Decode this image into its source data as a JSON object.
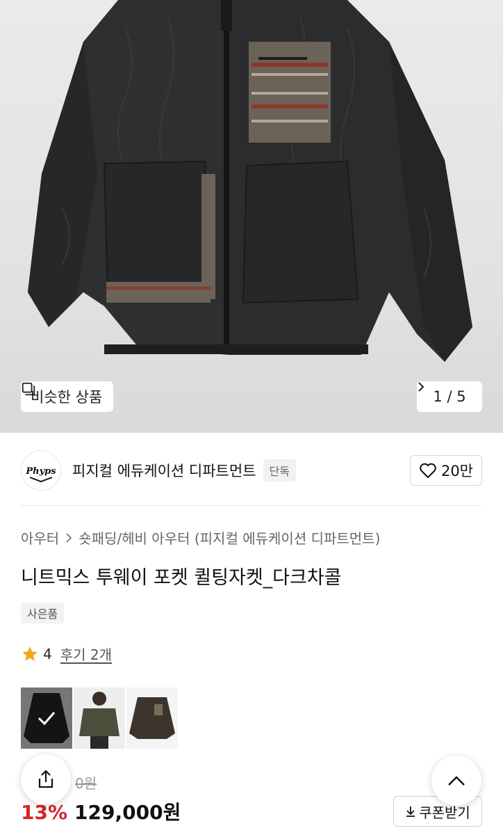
{
  "hero": {
    "similar_label": "비슷한 상품",
    "pager": "1 / 5"
  },
  "brand": {
    "logo_text": "Phyps",
    "name": "피지컬 에듀케이션 디파트먼트",
    "tag": "단독",
    "likes": "20만"
  },
  "breadcrumb": {
    "items": [
      "아우터",
      "숏패딩/헤비 아우터 (피지컬 에듀케이션 디파트먼트)"
    ]
  },
  "product": {
    "title": "니트믹스 투웨이 포켓 퀼팅자켓_다크차콜",
    "gift_badge": "사은품",
    "rating": "4",
    "reviews": "후기 2개",
    "original_price": "0원",
    "discount": "13%",
    "price": "129,000원",
    "coupon_label": "쿠폰받기"
  },
  "colors": {
    "options": [
      "다크차콜",
      "카키",
      "브라운"
    ],
    "selected_index": 0,
    "swatch_colors": [
      "#2a2a2a",
      "#4a4f3c",
      "#3d352d"
    ]
  },
  "theme": {
    "accent_red": "#d8232a",
    "star": "#f2a81d"
  }
}
